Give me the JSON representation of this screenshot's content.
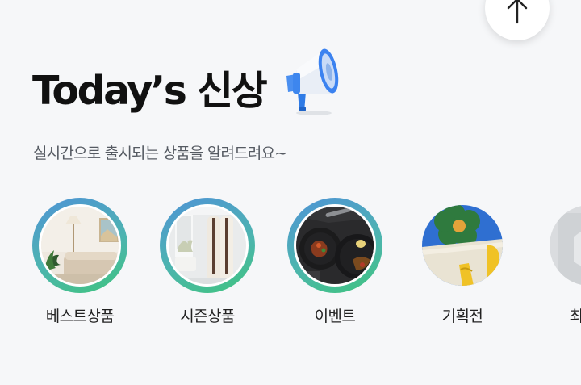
{
  "title": "Today’s 신상",
  "subtitle": "실시간으로 출시되는 상품을 알려드려요~",
  "scroll_top_icon": "arrow-up-icon",
  "header_icon": "megaphone-icon",
  "categories": [
    {
      "label": "베스트상품",
      "active": true
    },
    {
      "label": "시즌상품",
      "active": true
    },
    {
      "label": "이벤트",
      "active": true
    },
    {
      "label": "기획전",
      "active": false
    },
    {
      "label": "최근구",
      "active": false
    }
  ],
  "colors": {
    "ring_start": "#4f93d6",
    "ring_end": "#3fc47e",
    "background": "#f6f7f9"
  }
}
